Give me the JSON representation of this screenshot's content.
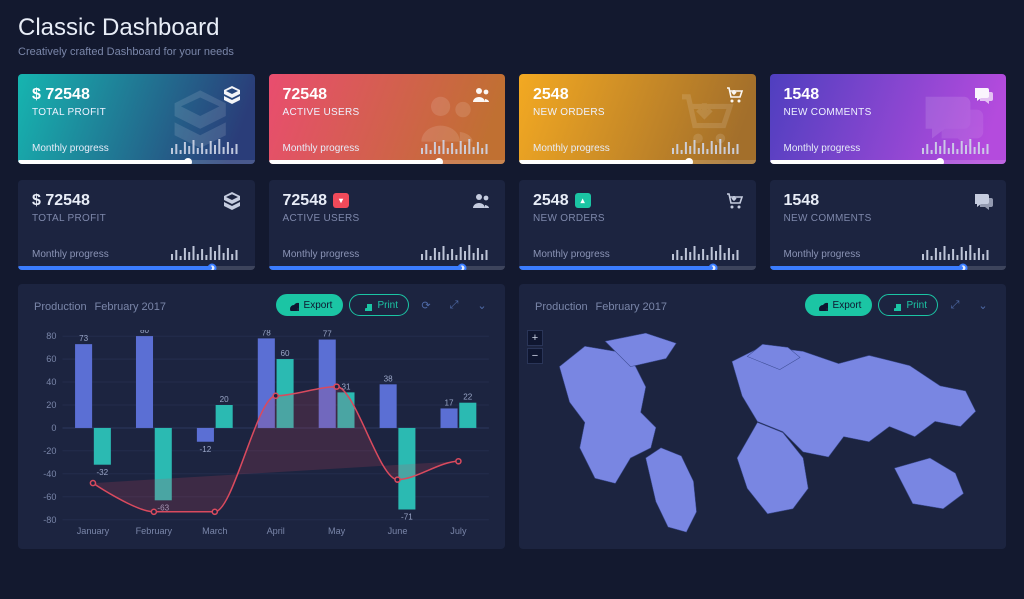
{
  "header": {
    "title": "Classic Dashboard",
    "subtitle": "Creatively crafted Dashboard for your needs"
  },
  "monthly_label": "Monthly progress",
  "cards_top": [
    {
      "value": "$ 72548",
      "label": "TOTAL PROFIT",
      "icon": "boxes-icon"
    },
    {
      "value": "72548",
      "label": "ACTIVE USERS",
      "icon": "users-icon"
    },
    {
      "value": "2548",
      "label": "NEW ORDERS",
      "icon": "cart-icon"
    },
    {
      "value": "1548",
      "label": "NEW COMMENTS",
      "icon": "comments-icon"
    }
  ],
  "cards_bottom": [
    {
      "value": "$ 72548",
      "label": "TOTAL PROFIT",
      "icon": "boxes-icon",
      "badge": null
    },
    {
      "value": "72548",
      "label": "ACTIVE USERS",
      "icon": "users-icon",
      "badge": "down"
    },
    {
      "value": "2548",
      "label": "NEW ORDERS",
      "icon": "cart-icon",
      "badge": "up"
    },
    {
      "value": "1548",
      "label": "NEW COMMENTS",
      "icon": "comments-icon",
      "badge": null
    }
  ],
  "panels": {
    "export": "Export",
    "print": "Print",
    "left": {
      "title": "Production",
      "period": "February 2017"
    },
    "right": {
      "title": "Production",
      "period": "February 2017"
    }
  },
  "chart_data": {
    "type": "bar",
    "categories": [
      "January",
      "February",
      "March",
      "April",
      "May",
      "June",
      "July"
    ],
    "ylim": [
      -80,
      80
    ],
    "series": [
      {
        "name": "blue",
        "values": [
          73,
          80,
          -12,
          78,
          77,
          38,
          17
        ],
        "color": "#5b6fd4"
      },
      {
        "name": "teal",
        "values": [
          -32,
          -63,
          20,
          60,
          31,
          -71,
          22
        ],
        "color": "#2bbab2"
      }
    ],
    "line": {
      "name": "red",
      "values": [
        -48,
        -73,
        -73,
        28,
        36,
        -45,
        -29
      ],
      "color": "#d94a5e"
    },
    "bar_labels": {
      "blue": [
        "73",
        "80",
        "-12",
        "78",
        "77",
        "38",
        "17"
      ],
      "teal": [
        "-32",
        "-63",
        "20",
        "60",
        "31",
        "-71",
        "22"
      ]
    }
  }
}
